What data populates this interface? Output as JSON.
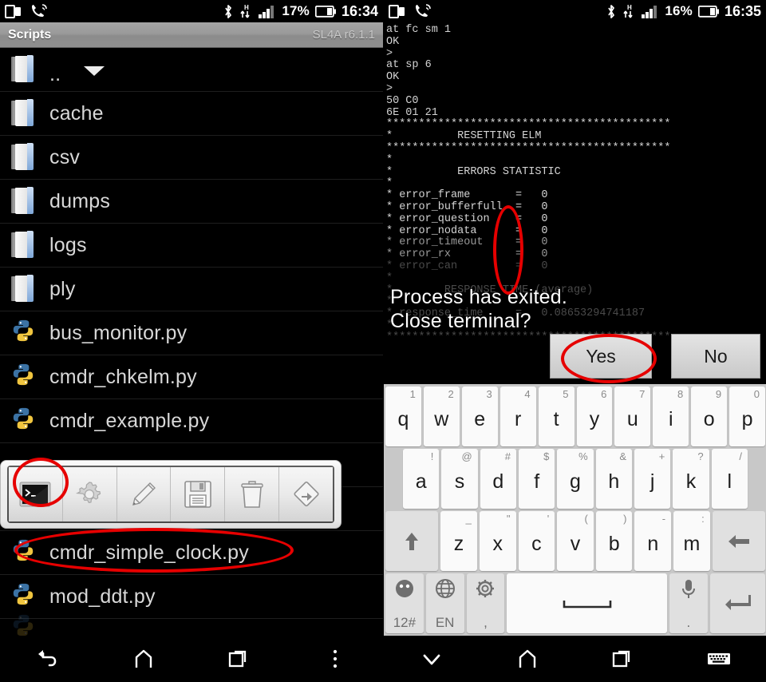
{
  "left_phone": {
    "status_bar": {
      "battery_percent": "17%",
      "clock": "16:34",
      "icons": [
        "multiwindow-icon",
        "call-signal-icon",
        "bluetooth-icon",
        "hspa-data-icon",
        "signal-bars-icon",
        "battery-icon"
      ]
    },
    "title_bar": {
      "title": "Scripts",
      "version": "SL4A r6.1.1"
    },
    "file_list": [
      {
        "name": "..",
        "type": "folder"
      },
      {
        "name": "cache",
        "type": "folder"
      },
      {
        "name": "csv",
        "type": "folder"
      },
      {
        "name": "dumps",
        "type": "folder"
      },
      {
        "name": "logs",
        "type": "folder"
      },
      {
        "name": "ply",
        "type": "folder"
      },
      {
        "name": "bus_monitor.py",
        "type": "python"
      },
      {
        "name": "cmdr_chkelm.py",
        "type": "python"
      },
      {
        "name": "cmdr_example.py",
        "type": "python"
      },
      {
        "name": "",
        "type": "hidden"
      },
      {
        "name": "",
        "type": "hidden"
      },
      {
        "name": "cmdr_simple_clock.py",
        "type": "python",
        "highlighted": true
      },
      {
        "name": "mod_ddt.py",
        "type": "python"
      },
      {
        "name": "",
        "type": "partial"
      }
    ],
    "context_toolbar": {
      "buttons": [
        {
          "label": "Start",
          "icon": "terminal-icon",
          "highlighted": true
        },
        {
          "label": "Start in Background",
          "icon": "gear-icon"
        },
        {
          "label": "Edit",
          "icon": "pencil-icon"
        },
        {
          "label": "Save",
          "icon": "floppy-disk-icon"
        },
        {
          "label": "Delete",
          "icon": "trash-icon"
        },
        {
          "label": "Rename",
          "icon": "rename-sign-icon"
        }
      ]
    },
    "nav_bar": [
      {
        "name": "back",
        "icon": "back-arrow-icon"
      },
      {
        "name": "home",
        "icon": "home-icon"
      },
      {
        "name": "recents",
        "icon": "recents-icon"
      },
      {
        "name": "menu",
        "icon": "overflow-menu-icon"
      }
    ]
  },
  "right_phone": {
    "status_bar": {
      "battery_percent": "16%",
      "clock": "16:35",
      "icons": [
        "multiwindow-icon",
        "call-signal-icon",
        "bluetooth-icon",
        "hspa-data-icon",
        "signal-bars-icon",
        "battery-icon"
      ]
    },
    "terminal": {
      "lines": [
        "at fc sm 1",
        "OK",
        "",
        ">",
        "at sp 6",
        "OK",
        "",
        ">",
        "50 C0",
        "6E 01 21",
        "********************************************",
        "*          RESETTING ELM",
        "********************************************",
        "*",
        "*          ERRORS STATISTIC",
        "*",
        "* error_frame       =   0",
        "* error_bufferfull  =   0",
        "* error_question    =   0",
        "* error_nodata      =   0",
        "* error_timeout     =   0",
        "* error_rx          =   0",
        "* error_can         =   0",
        "*",
        "*        RESPONSE TIME (average)",
        "*",
        "* response_time     =   0.08653294741187",
        "*",
        "********************************************"
      ]
    },
    "dialog": {
      "message_line1": "Process has exited.",
      "message_line2": "Close terminal?",
      "yes_label": "Yes",
      "no_label": "No",
      "yes_highlighted": true
    },
    "keyboard": {
      "row1": [
        {
          "main": "q",
          "sup": "1"
        },
        {
          "main": "w",
          "sup": "2"
        },
        {
          "main": "e",
          "sup": "3"
        },
        {
          "main": "r",
          "sup": "4"
        },
        {
          "main": "t",
          "sup": "5"
        },
        {
          "main": "y",
          "sup": "6"
        },
        {
          "main": "u",
          "sup": "7"
        },
        {
          "main": "i",
          "sup": "8"
        },
        {
          "main": "o",
          "sup": "9"
        },
        {
          "main": "p",
          "sup": "0"
        }
      ],
      "row2": [
        {
          "main": "a",
          "sup": "!"
        },
        {
          "main": "s",
          "sup": "@"
        },
        {
          "main": "d",
          "sup": "#"
        },
        {
          "main": "f",
          "sup": "$"
        },
        {
          "main": "g",
          "sup": "%"
        },
        {
          "main": "h",
          "sup": "&"
        },
        {
          "main": "j",
          "sup": "+"
        },
        {
          "main": "k",
          "sup": "?"
        },
        {
          "main": "l",
          "sup": "/"
        }
      ],
      "row3": [
        {
          "main": "z",
          "sup": "_"
        },
        {
          "main": "x",
          "sup": "\""
        },
        {
          "main": "c",
          "sup": "'"
        },
        {
          "main": "v",
          "sup": "("
        },
        {
          "main": "b",
          "sup": ")"
        },
        {
          "main": "n",
          "sup": "-"
        },
        {
          "main": "m",
          "sup": ":"
        }
      ],
      "shift_key": "shift-arrow-icon",
      "backspace_key": "backspace-arrow-icon",
      "row4": {
        "symbols_label": "12#",
        "symbols_icon": "emoji-face-icon",
        "language_label": "EN",
        "language_icon": "globe-icon",
        "settings_label": ",",
        "settings_icon": "gear-icon",
        "space_icon": "spacebar-icon",
        "mic_label": ".",
        "mic_icon": "microphone-icon",
        "enter_icon": "enter-arrow-icon"
      }
    },
    "nav_bar": [
      {
        "name": "hide-keyboard",
        "icon": "chevron-down-icon"
      },
      {
        "name": "home",
        "icon": "home-icon"
      },
      {
        "name": "recents",
        "icon": "recents-icon"
      },
      {
        "name": "keyboard",
        "icon": "keyboard-icon"
      }
    ]
  },
  "annotations": {
    "color": "#e60000",
    "marks": [
      "terminal-toolbar-button-circle",
      "script-row-circle",
      "error-values-circle",
      "yes-button-circle"
    ]
  }
}
